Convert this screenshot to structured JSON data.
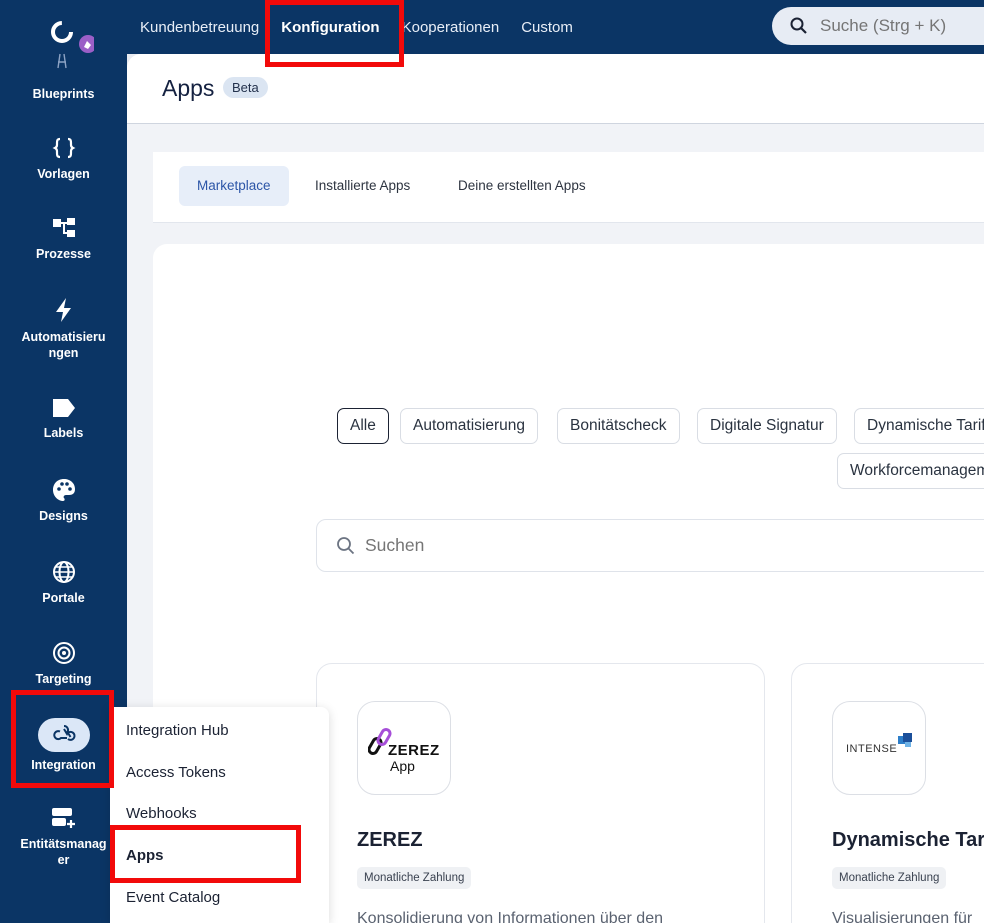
{
  "topnav": {
    "items": [
      "Kundenbetreuung",
      "Konfiguration",
      "Kooperationen",
      "Custom"
    ],
    "active": "Konfiguration"
  },
  "search_top": {
    "placeholder": "Suche (Strg + K)"
  },
  "sidebar": {
    "items": [
      {
        "label": "Blueprints",
        "icon": "blueprints-icon"
      },
      {
        "label": "Vorlagen",
        "icon": "curly-braces-icon"
      },
      {
        "label": "Prozesse",
        "icon": "process-icon"
      },
      {
        "label": "Automatisierungen",
        "icon": "lightning-icon"
      },
      {
        "label": "Labels",
        "icon": "tag-icon"
      },
      {
        "label": "Designs",
        "icon": "palette-icon"
      },
      {
        "label": "Portale",
        "icon": "globe-icon"
      },
      {
        "label": "Targeting",
        "icon": "target-icon"
      },
      {
        "label": "Integration",
        "icon": "webhook-icon"
      },
      {
        "label": "Entitätsmanager",
        "icon": "entity-manager-icon"
      }
    ],
    "labels_wrapped": {
      "automatisierungen": [
        "Automatisieru",
        "ngen"
      ],
      "entitaetsmanager": [
        "Entitätsmanag",
        "er"
      ]
    }
  },
  "header": {
    "title": "Apps",
    "badge": "Beta"
  },
  "tabs": [
    "Marketplace",
    "Installierte Apps",
    "Deine erstellten Apps"
  ],
  "filters": [
    "Alle",
    "Automatisierung",
    "Bonitätscheck",
    "Digitale Signatur",
    "Dynamische Tarife",
    "Workforcemanagement"
  ],
  "search_main": {
    "placeholder": "Suchen"
  },
  "cards": [
    {
      "title": "ZEREZ",
      "logo_text": [
        "ZEREZ",
        "App"
      ],
      "badge": "Monatliche Zahlung",
      "description": "Konsolidierung von Informationen über den"
    },
    {
      "title": "Dynamische Tarife",
      "logo_text": [
        "INTENSE"
      ],
      "badge": "Monatliche Zahlung",
      "description": "Visualisierungen für"
    }
  ],
  "flyout": {
    "items": [
      "Integration Hub",
      "Access Tokens",
      "Webhooks",
      "Apps",
      "Event Catalog"
    ]
  },
  "colors": {
    "sidebar": "#0b3565",
    "highlight": "#f20a0a",
    "accent": "#2c55a7"
  }
}
